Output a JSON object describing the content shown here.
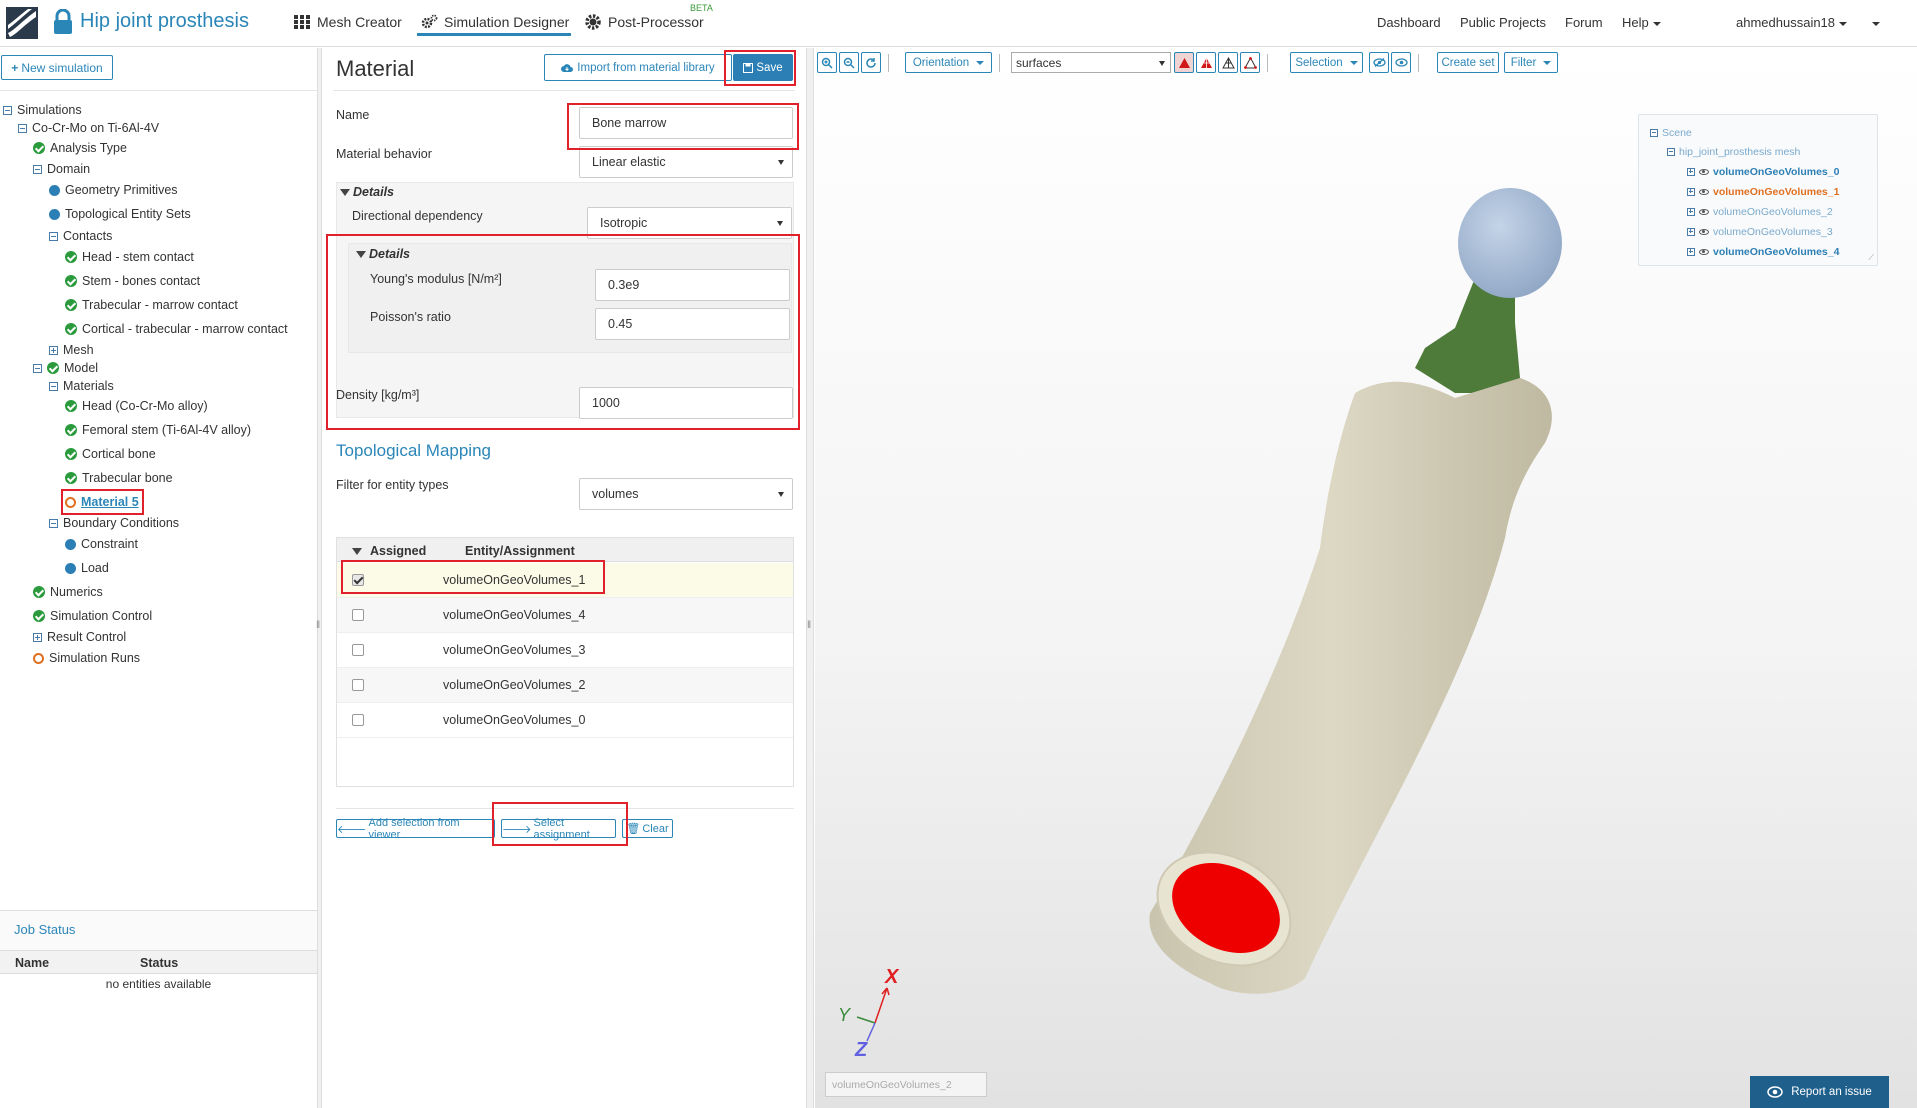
{
  "header": {
    "project_title": "Hip joint prosthesis",
    "nav": [
      {
        "label": "Mesh Creator"
      },
      {
        "label": "Simulation Designer"
      },
      {
        "label": "Post-Processor"
      }
    ],
    "beta_badge": "BETA",
    "right_links": [
      {
        "label": "Dashboard"
      },
      {
        "label": "Public Projects"
      },
      {
        "label": "Forum"
      },
      {
        "label": "Help"
      }
    ],
    "username": "ahmedhussain18",
    "accent_color": "#2b86b8"
  },
  "left_panel": {
    "new_simulation_label": "New simulation",
    "tree": {
      "simulations": "Simulations",
      "simulation_name": "Co-Cr-Mo on Ti-6Al-4V",
      "analysis_type": "Analysis Type",
      "domain": "Domain",
      "geometry_primitives": "Geometry Primitives",
      "topological_entity_sets": "Topological Entity Sets",
      "contacts": "Contacts",
      "contact_items": [
        "Head - stem contact",
        "Stem - bones contact",
        "Trabecular - marrow contact",
        "Cortical - trabecular - marrow contact"
      ],
      "mesh": "Mesh",
      "model": "Model",
      "materials": "Materials",
      "material_items": [
        "Head (Co-Cr-Mo alloy)",
        "Femoral stem (Ti-6Al-4V alloy)",
        "Cortical bone",
        "Trabecular bone"
      ],
      "material_5": "Material 5",
      "boundary_conditions": "Boundary Conditions",
      "bc_items": [
        "Constraint",
        "Load"
      ],
      "numerics": "Numerics",
      "simulation_control": "Simulation Control",
      "result_control": "Result Control",
      "simulation_runs": "Simulation Runs"
    },
    "job_status": {
      "title": "Job Status",
      "columns": [
        "Name",
        "Status"
      ],
      "empty_text": "no entities available"
    }
  },
  "material_panel": {
    "title": "Material",
    "import_label": "Import from material library",
    "save_label": "Save",
    "name_label": "Name",
    "name_value": "Bone marrow",
    "behavior_label": "Material behavior",
    "behavior_value": "Linear elastic",
    "details_label": "Details",
    "directional_label": "Directional dependency",
    "directional_value": "Isotropic",
    "inner_details_label": "Details",
    "youngs_label": "Young's modulus [N/m²]",
    "youngs_value": "0.3e9",
    "poisson_label": "Poisson's ratio",
    "poisson_value": "0.45",
    "density_label": "Density [kg/m³]",
    "density_value": "1000",
    "topo_title": "Topological Mapping",
    "filter_label": "Filter for entity types",
    "filter_value": "volumes",
    "table_headers": [
      "Assigned",
      "Entity/Assignment"
    ],
    "rows": [
      {
        "entity": "volumeOnGeoVolumes_1",
        "assigned": true
      },
      {
        "entity": "volumeOnGeoVolumes_4",
        "assigned": false
      },
      {
        "entity": "volumeOnGeoVolumes_3",
        "assigned": false
      },
      {
        "entity": "volumeOnGeoVolumes_2",
        "assigned": false
      },
      {
        "entity": "volumeOnGeoVolumes_0",
        "assigned": false
      }
    ],
    "add_selection_label": "Add selection from viewer",
    "select_assignment_label": "Select assignment",
    "clear_label": "Clear"
  },
  "viewer": {
    "orientation_label": "Orientation",
    "render_mode": "surfaces",
    "selection_label": "Selection",
    "create_set_label": "Create set",
    "filter_label": "Filter",
    "scene": {
      "root": "Scene",
      "mesh": "hip_joint_prosthesis mesh",
      "volumes": [
        {
          "label": "volumeOnGeoVolumes_0",
          "color": "#2b7fb5",
          "bold": true
        },
        {
          "label": "volumeOnGeoVolumes_1",
          "color": "#e07020",
          "bold": true
        },
        {
          "label": "volumeOnGeoVolumes_2",
          "color": "#7aaacc",
          "bold": false
        },
        {
          "label": "volumeOnGeoVolumes_3",
          "color": "#7aaacc",
          "bold": false
        },
        {
          "label": "volumeOnGeoVolumes_4",
          "color": "#2b7fb5",
          "bold": true
        }
      ]
    },
    "axes": {
      "x": "X",
      "y": "Y",
      "z": "Z"
    },
    "hover_entity": "volumeOnGeoVolumes_2",
    "report_issue_label": "Report an issue",
    "colors": {
      "bone": "#d6d2c0",
      "bone_shade": "#c8c3ad",
      "head": "#a9bdd6",
      "neck": "#4e7a3a",
      "marrow": "#ee0000"
    }
  }
}
